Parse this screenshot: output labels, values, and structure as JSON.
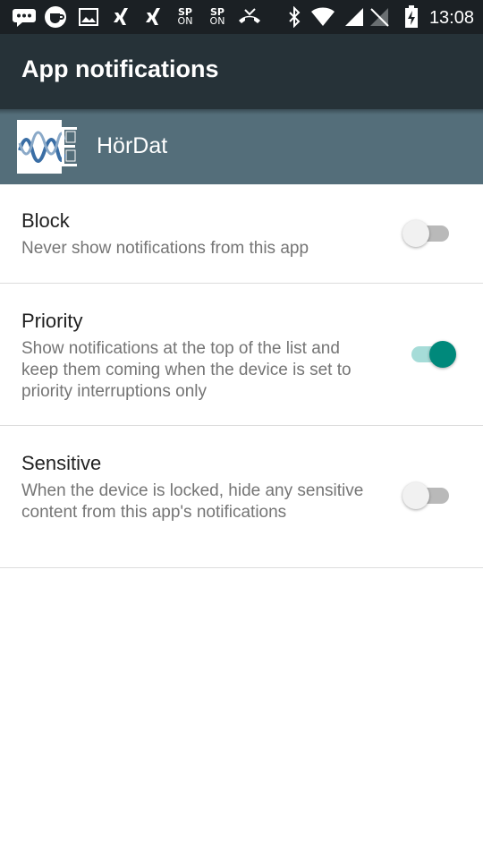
{
  "status_bar": {
    "time": "13:08",
    "sp_on_1": {
      "top": "SP",
      "bottom": "ON"
    },
    "sp_on_2": {
      "top": "SP",
      "bottom": "ON"
    },
    "icons": [
      "chat-icon",
      "coffee-icon",
      "image-icon",
      "xing-icon",
      "xing-icon",
      "sp-on-icon",
      "sp-on-icon",
      "missed-call-icon",
      "bluetooth-icon",
      "wifi-icon",
      "signal-icon",
      "no-signal-icon",
      "battery-charging-icon"
    ]
  },
  "app_bar": {
    "title": "App notifications"
  },
  "app_header": {
    "name": "HörDat"
  },
  "settings": {
    "block": {
      "title": "Block",
      "summary": "Never show notifications from this app",
      "enabled": false
    },
    "priority": {
      "title": "Priority",
      "summary": "Show notifications at the top of the list and keep them coming when the device is set to priority interruptions only",
      "enabled": true
    },
    "sensitive": {
      "title": "Sensitive",
      "summary": "When the device is locked, hide any sensitive content from this app's notifications",
      "enabled": false
    }
  },
  "colors": {
    "status_bar": "#1b2024",
    "app_bar": "#263238",
    "app_header": "#546e7a",
    "switch_on": "#00897b",
    "switch_on_track": "#a6dcd8",
    "switch_off_track": "#b9b9b9"
  }
}
